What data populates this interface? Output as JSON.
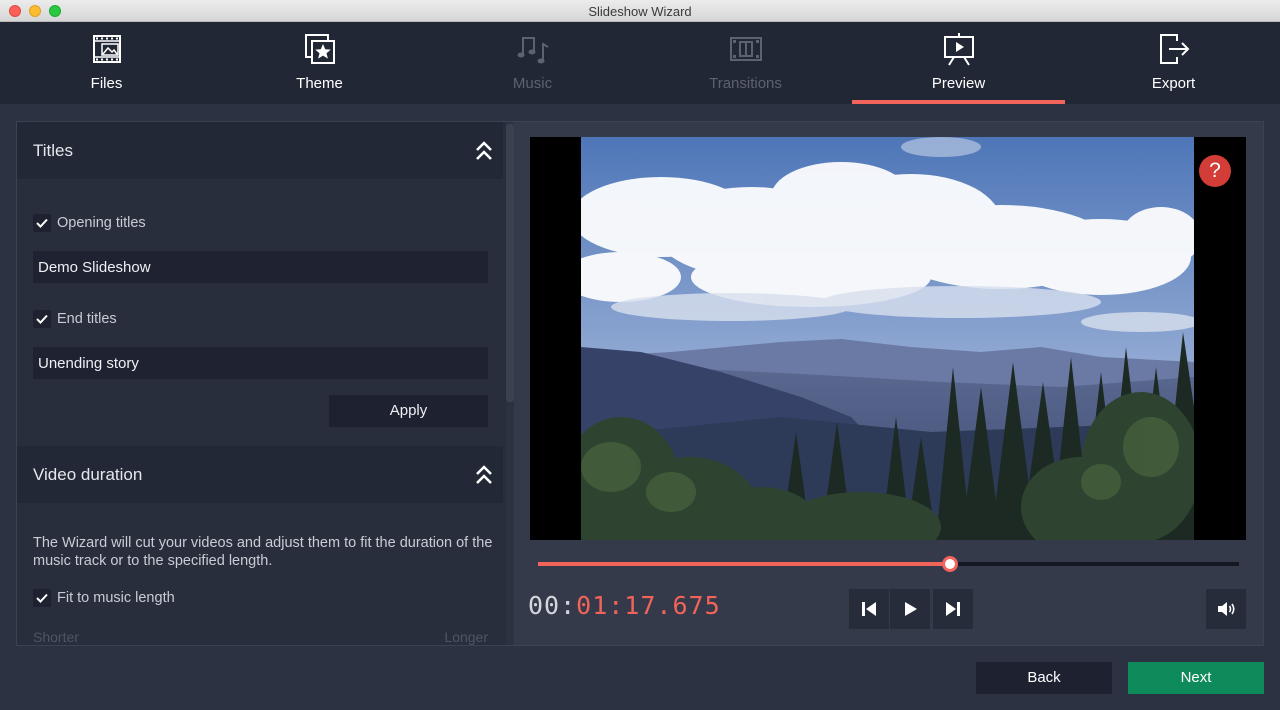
{
  "window": {
    "title": "Slideshow Wizard"
  },
  "steps": [
    {
      "label": "Files",
      "icon": "files-icon",
      "state": "enabled"
    },
    {
      "label": "Theme",
      "icon": "theme-icon",
      "state": "enabled"
    },
    {
      "label": "Music",
      "icon": "music-icon",
      "state": "disabled"
    },
    {
      "label": "Transitions",
      "icon": "transitions-icon",
      "state": "disabled"
    },
    {
      "label": "Preview",
      "icon": "preview-icon",
      "state": "active"
    },
    {
      "label": "Export",
      "icon": "export-icon",
      "state": "enabled"
    }
  ],
  "titles_section": {
    "heading": "Titles",
    "opening_label": "Opening titles",
    "opening_checked": true,
    "opening_value": "Demo Slideshow",
    "end_label": "End titles",
    "end_checked": true,
    "end_value": "Unending story",
    "apply_label": "Apply"
  },
  "duration_section": {
    "heading": "Video duration",
    "description": "The Wizard will cut your videos and adjust them to fit the duration of the music track or to the specified length.",
    "fit_label": "Fit to music length",
    "fit_checked": true,
    "shorter_label": "Shorter",
    "longer_label": "Longer"
  },
  "player": {
    "help_label": "?",
    "timecode_dim": "00:",
    "timecode_lit": "01:17.675",
    "progress_fraction": 0.588,
    "controls": [
      "skip-back-icon",
      "play-icon",
      "skip-forward-icon",
      "volume-icon"
    ]
  },
  "footer": {
    "back_label": "Back",
    "next_label": "Next"
  },
  "colors": {
    "accent": "#f2635a",
    "next_button": "#0f8a5b",
    "background": "#2c3242"
  }
}
